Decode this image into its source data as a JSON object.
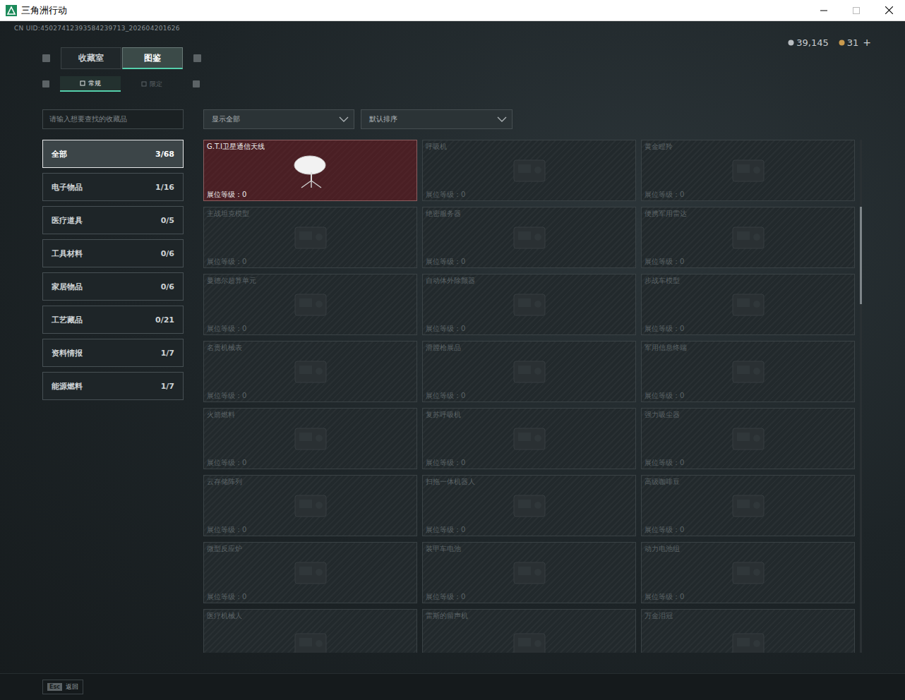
{
  "window": {
    "title": "三角洲行动"
  },
  "uid": "CN UID:45027412393584239713_202604201626",
  "currency": [
    {
      "amount": "39,145",
      "color": "#b9bec2"
    },
    {
      "amount": "31",
      "color": "#c99a4e"
    }
  ],
  "add_button": "+",
  "tabs": [
    {
      "label": "收藏室",
      "selected": false
    },
    {
      "label": "图鉴",
      "selected": true
    }
  ],
  "subtabs": [
    {
      "label": "常规",
      "selected": true
    },
    {
      "label": "限定",
      "selected": false
    }
  ],
  "search": {
    "placeholder": "请输入想要查找的收藏品"
  },
  "filters": [
    "显示全部",
    "默认排序"
  ],
  "categories": [
    {
      "name": "全部",
      "count": "3/68",
      "selected": true
    },
    {
      "name": "电子物品",
      "count": "1/16",
      "selected": false
    },
    {
      "name": "医疗道具",
      "count": "0/5",
      "selected": false
    },
    {
      "name": "工具材料",
      "count": "0/6",
      "selected": false
    },
    {
      "name": "家居物品",
      "count": "0/6",
      "selected": false
    },
    {
      "name": "工艺藏品",
      "count": "0/21",
      "selected": false
    },
    {
      "name": "资料情报",
      "count": "1/7",
      "selected": false
    },
    {
      "name": "能源燃料",
      "count": "1/7",
      "selected": false
    }
  ],
  "items": [
    {
      "name": "G.T.I卫星通信天线",
      "level": "展位等级：0",
      "collected": true
    },
    {
      "name": "呼吸机",
      "level": "展位等级：0",
      "collected": false
    },
    {
      "name": "黄金瞪羚",
      "level": "展位等级：0",
      "collected": false
    },
    {
      "name": "主战坦克模型",
      "level": "展位等级：0",
      "collected": false
    },
    {
      "name": "绝密服务器",
      "level": "展位等级：0",
      "collected": false
    },
    {
      "name": "便携军用雷达",
      "level": "展位等级：0",
      "collected": false
    },
    {
      "name": "曼德尔超算单元",
      "level": "展位等级：0",
      "collected": false
    },
    {
      "name": "自动体外除颤器",
      "level": "展位等级：0",
      "collected": false
    },
    {
      "name": "步战车模型",
      "level": "展位等级：0",
      "collected": false
    },
    {
      "name": "名贵机械表",
      "level": "展位等级：0",
      "collected": false
    },
    {
      "name": "滑膛枪展品",
      "level": "展位等级：0",
      "collected": false
    },
    {
      "name": "军用信息终端",
      "level": "展位等级：0",
      "collected": false
    },
    {
      "name": "火箭燃料",
      "level": "展位等级：0",
      "collected": false
    },
    {
      "name": "复苏呼吸机",
      "level": "展位等级：0",
      "collected": false
    },
    {
      "name": "强力吸尘器",
      "level": "展位等级：0",
      "collected": false
    },
    {
      "name": "云存储阵列",
      "level": "展位等级：0",
      "collected": false
    },
    {
      "name": "扫拖一体机器人",
      "level": "展位等级：0",
      "collected": false
    },
    {
      "name": "高级咖啡豆",
      "level": "展位等级：0",
      "collected": false
    },
    {
      "name": "微型反应炉",
      "level": "展位等级：0",
      "collected": false
    },
    {
      "name": "装甲车电池",
      "level": "展位等级：0",
      "collected": false
    },
    {
      "name": "动力电池组",
      "level": "展位等级：0",
      "collected": false
    },
    {
      "name": "医疗机械人",
      "collected": false
    },
    {
      "name": "雷斯的留声机",
      "collected": false
    },
    {
      "name": "万金泪冠",
      "collected": false
    }
  ],
  "scrollbar": {
    "start": 0.13,
    "level": 0.19
  },
  "footer": {
    "key": "Esc",
    "label": "返回"
  }
}
